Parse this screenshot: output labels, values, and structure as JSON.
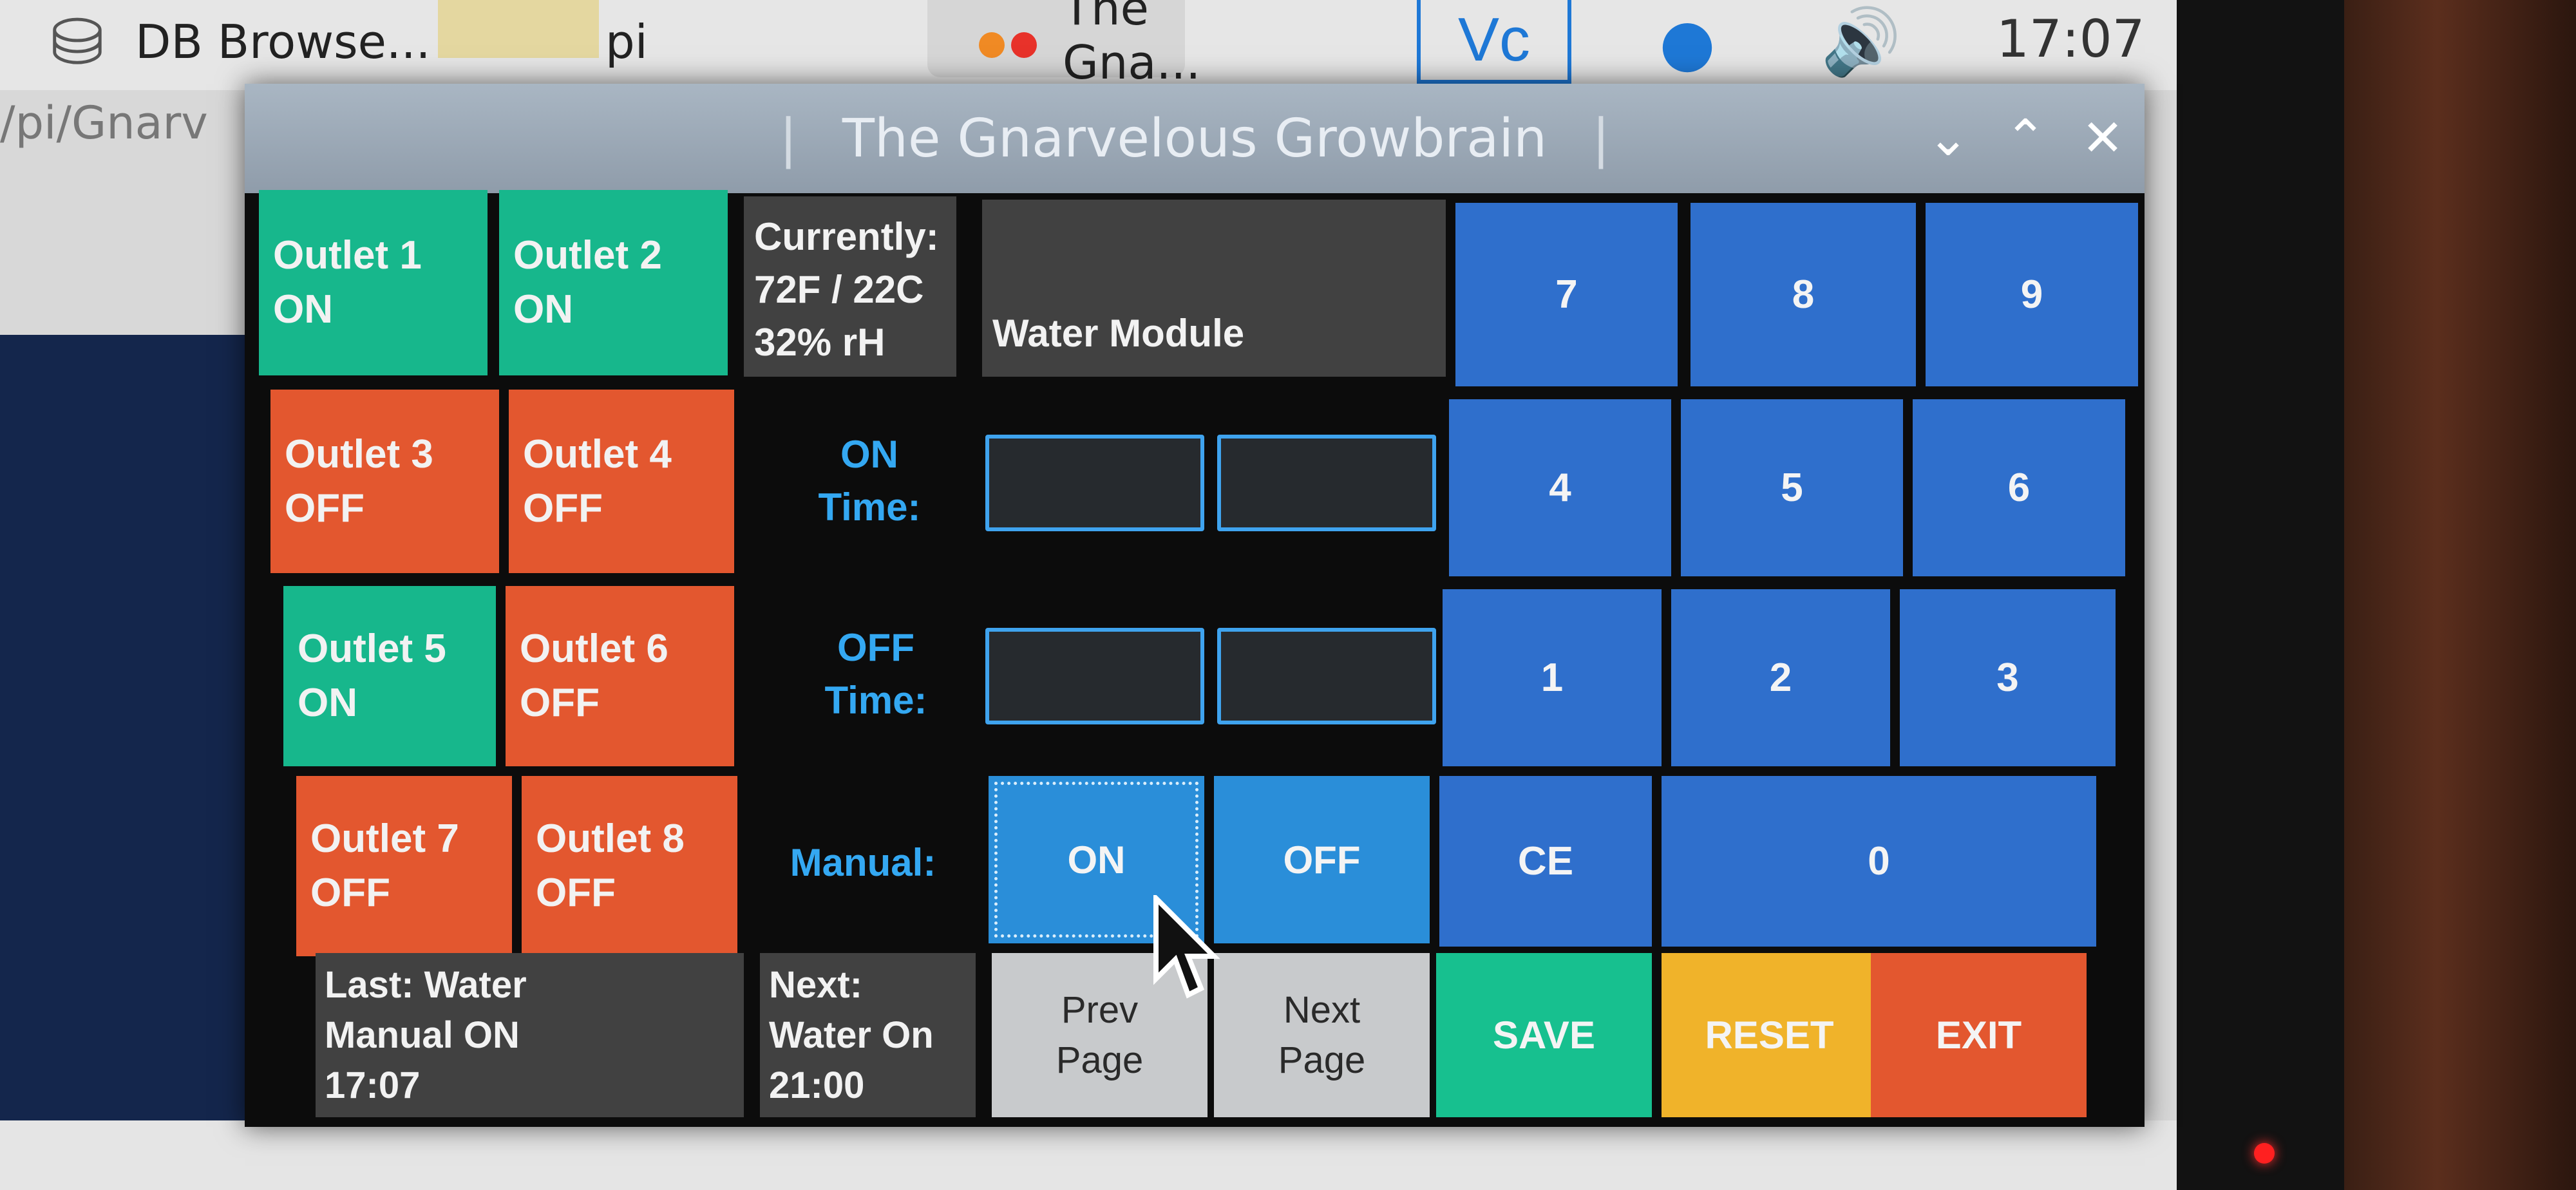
{
  "taskbar": {
    "items": [
      {
        "label": "DB Browse..."
      },
      {
        "label": "pi"
      },
      {
        "label": "The Gna..."
      }
    ],
    "clock": "17:07"
  },
  "background": {
    "path_text": "/pi/Gnarv"
  },
  "window": {
    "title": "The Gnarvelous Growbrain",
    "title_separator": "|"
  },
  "outlets": [
    {
      "name": "Outlet 1",
      "state": "ON"
    },
    {
      "name": "Outlet 2",
      "state": "ON"
    },
    {
      "name": "Outlet 3",
      "state": "OFF"
    },
    {
      "name": "Outlet 4",
      "state": "OFF"
    },
    {
      "name": "Outlet 5",
      "state": "ON"
    },
    {
      "name": "Outlet 6",
      "state": "OFF"
    },
    {
      "name": "Outlet 7",
      "state": "OFF"
    },
    {
      "name": "Outlet 8",
      "state": "OFF"
    }
  ],
  "currently": {
    "heading": "Currently:",
    "temperature": "72F / 22C",
    "humidity": "32% rH"
  },
  "module": {
    "name": "Water Module"
  },
  "schedule": {
    "on_label_1": "ON",
    "on_label_2": "Time:",
    "off_label_1": "OFF",
    "off_label_2": "Time:",
    "manual_label": "Manual:",
    "on_hour": "",
    "on_minute": "",
    "off_hour": "",
    "off_minute": "",
    "manual_on": "ON",
    "manual_off": "OFF"
  },
  "keypad": {
    "k7": "7",
    "k8": "8",
    "k9": "9",
    "k4": "4",
    "k5": "5",
    "k6": "6",
    "k1": "1",
    "k2": "2",
    "k3": "3",
    "kce": "CE",
    "k0": "0"
  },
  "status": {
    "last_line1": "Last: Water",
    "last_line2": "Manual ON",
    "last_line3": "17:07",
    "next_line1": "Next:",
    "next_line2": "Water On",
    "next_line3": "21:00"
  },
  "nav": {
    "prev_line1": "Prev",
    "prev_line2": "Page",
    "next_line1": "Next",
    "next_line2": "Page"
  },
  "actions": {
    "save": "SAVE",
    "reset": "RESET",
    "exit": "EXIT"
  },
  "colors": {
    "on": "#17b78c",
    "off": "#e3572f",
    "keypad": "#2f6fcc",
    "save": "#17c08f",
    "reset": "#f0b32a",
    "exit": "#e3572f"
  }
}
